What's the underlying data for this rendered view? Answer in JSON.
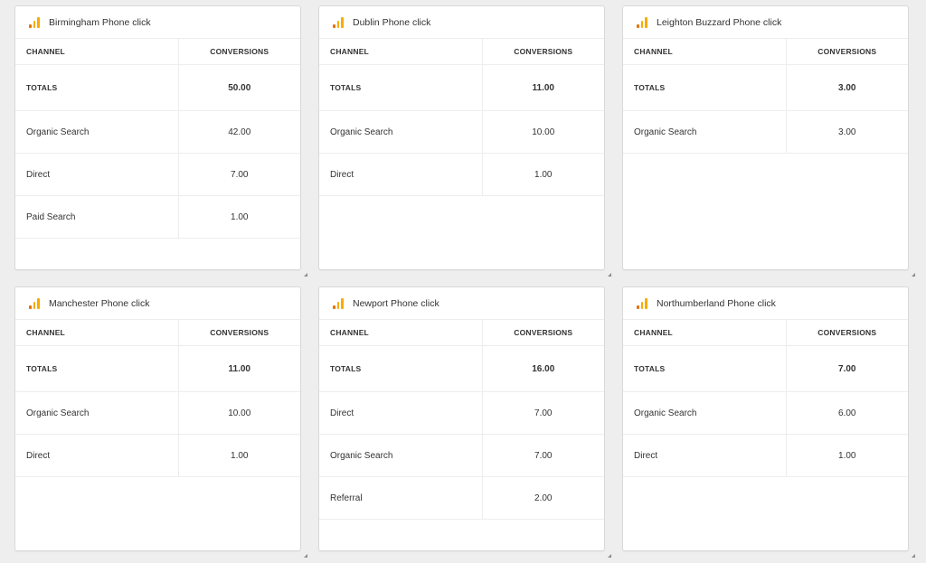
{
  "colors": {
    "background": "#eeeeef",
    "card": "#ffffff",
    "icon_dark": "#e37400",
    "icon_light": "#f9ab00"
  },
  "table_headers": {
    "channel": "CHANNEL",
    "conversions": "CONVERSIONS"
  },
  "totals_label": "TOTALS",
  "widgets": [
    {
      "title": "Birmingham Phone click",
      "icon": "google-analytics-icon",
      "totals": "50.00",
      "rows": [
        {
          "channel": "Organic Search",
          "conversions": "42.00"
        },
        {
          "channel": "Direct",
          "conversions": "7.00"
        },
        {
          "channel": "Paid Search",
          "conversions": "1.00"
        }
      ]
    },
    {
      "title": "Dublin Phone click",
      "icon": "google-analytics-icon",
      "totals": "11.00",
      "rows": [
        {
          "channel": "Organic Search",
          "conversions": "10.00"
        },
        {
          "channel": "Direct",
          "conversions": "1.00"
        }
      ]
    },
    {
      "title": "Leighton Buzzard Phone click",
      "icon": "google-analytics-icon",
      "totals": "3.00",
      "rows": [
        {
          "channel": "Organic Search",
          "conversions": "3.00"
        }
      ]
    },
    {
      "title": "Manchester Phone click",
      "icon": "google-analytics-icon",
      "totals": "11.00",
      "rows": [
        {
          "channel": "Organic Search",
          "conversions": "10.00"
        },
        {
          "channel": "Direct",
          "conversions": "1.00"
        }
      ]
    },
    {
      "title": "Newport Phone click",
      "icon": "google-analytics-icon",
      "totals": "16.00",
      "rows": [
        {
          "channel": "Direct",
          "conversions": "7.00"
        },
        {
          "channel": "Organic Search",
          "conversions": "7.00"
        },
        {
          "channel": "Referral",
          "conversions": "2.00"
        }
      ]
    },
    {
      "title": "Northumberland Phone click",
      "icon": "google-analytics-icon",
      "totals": "7.00",
      "rows": [
        {
          "channel": "Organic Search",
          "conversions": "6.00"
        },
        {
          "channel": "Direct",
          "conversions": "1.00"
        }
      ]
    }
  ]
}
